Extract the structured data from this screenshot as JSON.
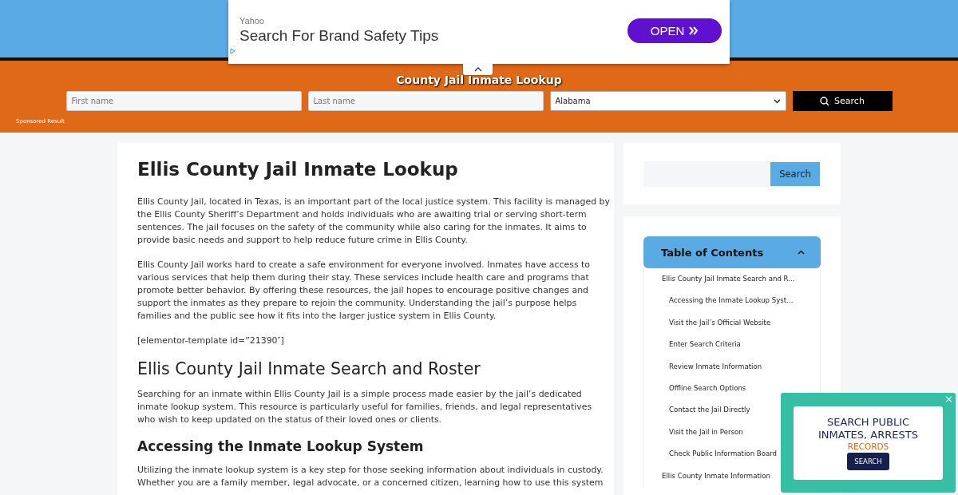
{
  "ad": {
    "source": "Yahoo",
    "headline": "Search For Brand Safety Tips",
    "button": "OPEN"
  },
  "header": {
    "title": "County Jail Inmate Lookup",
    "first_name": {
      "placeholder": "First name"
    },
    "last_name": {
      "placeholder": "Last name"
    },
    "state": {
      "value": "Alabama"
    },
    "search_button": "Search",
    "sponsored": "Sponsored Result"
  },
  "article": {
    "title": "Ellis County Jail Inmate Lookup",
    "blocks": [
      {
        "kind": "p",
        "text": "Ellis County Jail, located in Texas, is an important part of the local justice system. This facility is managed by the Ellis County Sheriff’s Department and holds individuals who are awaiting trial or serving short-term sentences. The jail focuses on the safety of the community while also caring for the inmates. It aims to provide basic needs and support to help reduce future crime in Ellis County."
      },
      {
        "kind": "p",
        "text": "Ellis County Jail works hard to create a safe environment for everyone involved. Inmates have access to various services that help them during their stay. These services include health care and programs that promote better behavior. By offering these resources, the jail hopes to encourage positive changes and support the inmates as they prepare to rejoin the community. Understanding the jail’s purpose helps families and the public see how it fits into the larger justice system in Ellis County."
      },
      {
        "kind": "p",
        "text": "[elementor-template id=”21390″]"
      },
      {
        "kind": "h2",
        "text": "Ellis County Jail Inmate Search and Roster"
      },
      {
        "kind": "p",
        "text": "Searching for an inmate within Ellis County Jail is a simple process made easier by the jail’s dedicated inmate lookup system. This resource is particularly useful for families, friends, and legal representatives who wish to keep updated on the status of their loved ones or clients."
      },
      {
        "kind": "h3",
        "text": "Accessing the Inmate Lookup System"
      },
      {
        "kind": "p",
        "text": "Utilizing the inmate lookup system is a key step for those seeking information about individuals in custody. Whether you are a family member, legal advocate, or a concerned citizen, learning how to use this system"
      }
    ]
  },
  "sidebar": {
    "search_button": "Search",
    "toc": {
      "title": "Table of Contents",
      "expanded": true,
      "items": [
        {
          "label": "Ellis County Jail Inmate Search and R...",
          "children": [
            {
              "label": "Accessing the Inmate Lookup Syst..."
            },
            {
              "label": "Visit the Jail’s Official Website"
            },
            {
              "label": "Enter Search Criteria"
            },
            {
              "label": "Review Inmate Information"
            },
            {
              "label": "Offline Search Options"
            },
            {
              "label": "Contact the Jail Directly"
            },
            {
              "label": "Visit the Jail in Person"
            },
            {
              "label": "Check Public Information Board"
            }
          ]
        },
        {
          "label": "Ellis County Inmate Information"
        }
      ]
    }
  },
  "popup": {
    "close": "×",
    "line1": "SEARCH PUBLIC",
    "line2": "INMATES, ARRESTS",
    "line3": "RECORDS",
    "button": "SEARCH"
  }
}
